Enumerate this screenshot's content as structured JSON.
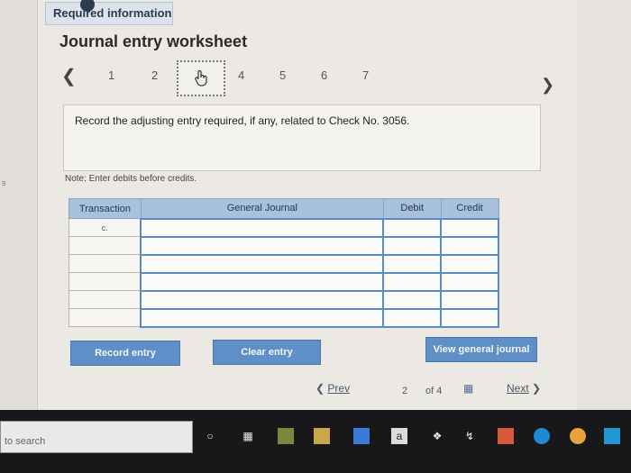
{
  "header": {
    "required_info": "Required information",
    "title": "Journal entry worksheet"
  },
  "steps": {
    "items": [
      "1",
      "2",
      "3",
      "4",
      "5",
      "6",
      "7"
    ],
    "active": "3"
  },
  "prompt": "Record the adjusting entry required, if any, related to Check No. 3056.",
  "note": "Note: Enter debits before credits.",
  "table": {
    "columns": [
      "Transaction",
      "General Journal",
      "Debit",
      "Credit"
    ],
    "rows": [
      {
        "transaction": "c.",
        "account": "",
        "debit": "",
        "credit": ""
      },
      {
        "transaction": "",
        "account": "",
        "debit": "",
        "credit": ""
      },
      {
        "transaction": "",
        "account": "",
        "debit": "",
        "credit": ""
      },
      {
        "transaction": "",
        "account": "",
        "debit": "",
        "credit": ""
      },
      {
        "transaction": "",
        "account": "",
        "debit": "",
        "credit": ""
      },
      {
        "transaction": "",
        "account": "",
        "debit": "",
        "credit": ""
      }
    ]
  },
  "buttons": {
    "record": "Record entry",
    "clear": "Clear entry",
    "view": "View general journal"
  },
  "pager": {
    "prev": "Prev",
    "current": "2",
    "of": "of 4",
    "next": "Next"
  },
  "taskbar": {
    "search_text": "to search"
  },
  "colors": {
    "header_blue": "#a8c1dc",
    "button_blue": "#5e8fc7",
    "entry_border": "#5b8bc4"
  }
}
